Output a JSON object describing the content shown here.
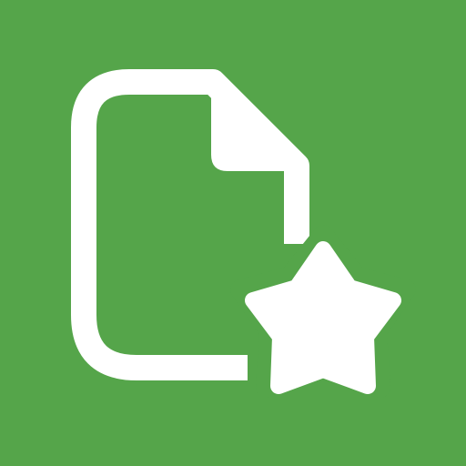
{
  "icon": {
    "name": "favorite-file-icon",
    "parts": [
      "document-icon",
      "star-icon"
    ]
  },
  "colors": {
    "background": "#55a54a",
    "glyph": "#ffffff"
  }
}
